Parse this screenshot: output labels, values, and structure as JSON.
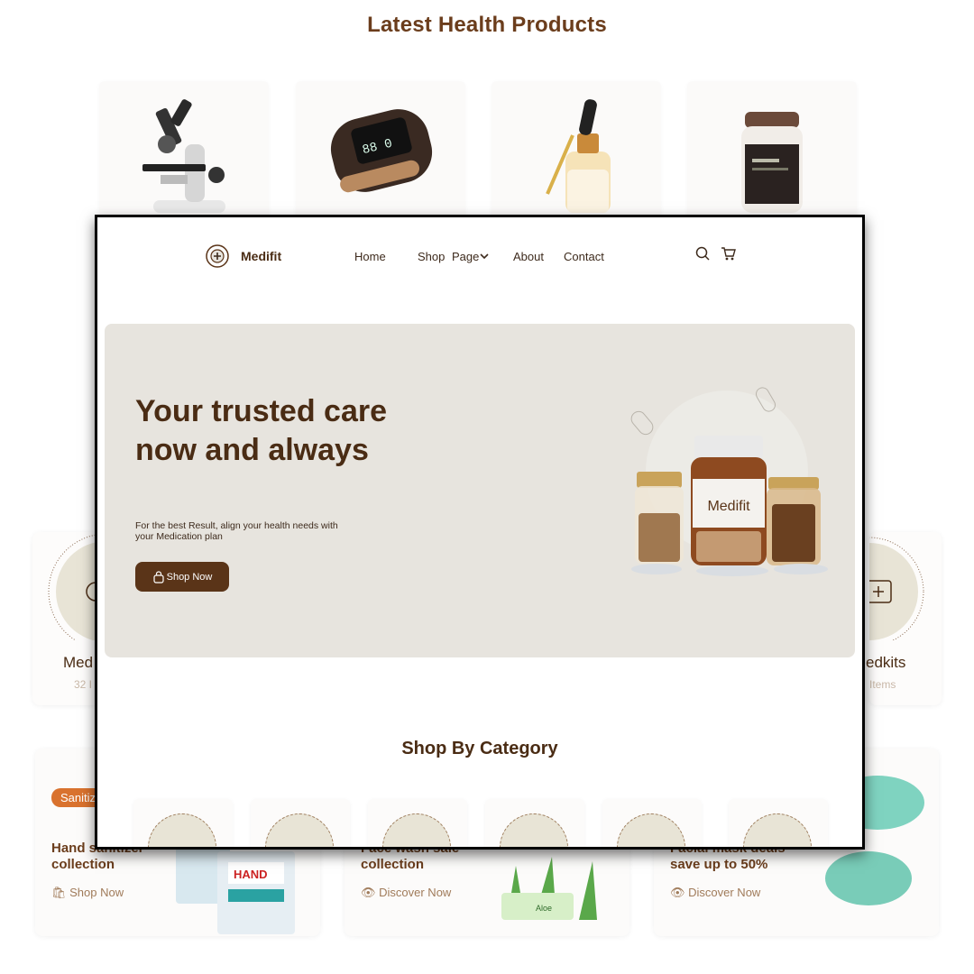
{
  "background": {
    "section_title": "Latest Health Products",
    "category_left": {
      "name": "Med",
      "count": "32 I"
    },
    "category_right": {
      "name": "edkits",
      "count": "Items"
    },
    "promos": [
      {
        "badge": "Sanitiz",
        "title": "Hand sanitizer collection",
        "link": "Shop Now"
      },
      {
        "title": "Face wash sale collection",
        "link": "Discover Now"
      },
      {
        "title": "Facial mask deals save up to 50%",
        "link": "Discover Now"
      }
    ]
  },
  "window": {
    "brand": "Medifit",
    "menu": [
      "Home",
      "Shop",
      "Page",
      "About",
      "Contact"
    ],
    "hero": {
      "heading": "Your trusted care now and always",
      "subtext": "For the best Result, align your health needs with your Medication plan",
      "button": "Shop Now",
      "bottle_label": "Medifit"
    },
    "shop_by_category": "Shop By Category"
  },
  "colors": {
    "brand_brown": "#5a3418",
    "hero_bg": "#e7e4de",
    "accent_orange": "#d9722e"
  }
}
